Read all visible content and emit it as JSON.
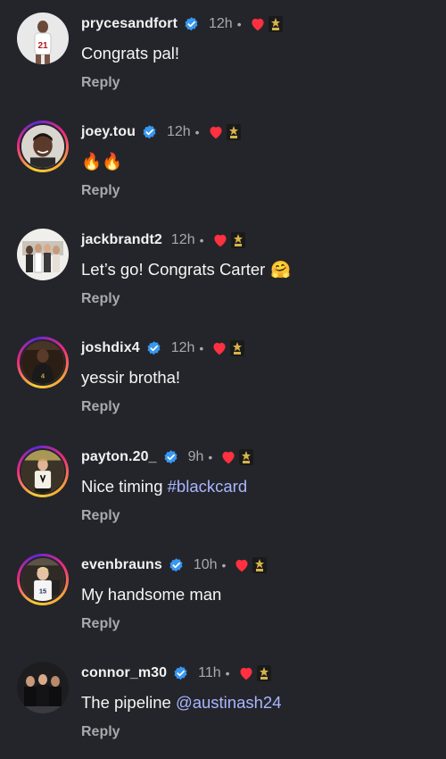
{
  "colors": {
    "background": "#24252a",
    "username": "#f2f2f2",
    "muted": "#a8a9ad",
    "verified": "#3897f0",
    "heart": "#ff3040",
    "link": "#a9b6ff"
  },
  "comments": [
    {
      "username": "prycesandfort",
      "verified": true,
      "time": "12h",
      "dot": "•",
      "text": "Congrats pal!",
      "reply": "Reply"
    },
    {
      "username": "joey.tou",
      "verified": true,
      "time": "12h",
      "dot": "•",
      "emoji": "🔥🔥",
      "reply": "Reply"
    },
    {
      "username": "jackbrandt2",
      "verified": false,
      "time": "12h",
      "dot": "•",
      "text": "Let’s go! Congrats Carter",
      "emoji": "🤗",
      "reply": "Reply"
    },
    {
      "username": "joshdix4",
      "verified": true,
      "time": "12h",
      "dot": "•",
      "text": "yessir brotha!",
      "reply": "Reply"
    },
    {
      "username": "payton.20_",
      "verified": true,
      "time": "9h",
      "dot": "•",
      "text": "Nice timing ",
      "hashtag": "#blackcard",
      "reply": "Reply"
    },
    {
      "username": "evenbrauns",
      "verified": true,
      "time": "10h",
      "dot": "•",
      "text": "My handsome man",
      "reply": "Reply"
    },
    {
      "username": "connor_m30",
      "verified": true,
      "time": "11h",
      "dot": "•",
      "text": "The pipeline ",
      "mention": "@austinash24",
      "reply": "Reply"
    }
  ]
}
